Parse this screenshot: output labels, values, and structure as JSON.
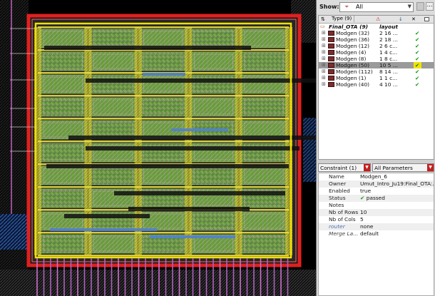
{
  "show_bar": {
    "label": "Show:",
    "filter_value": "All",
    "filter_icon": "funnel-icon"
  },
  "tree": {
    "columns": {
      "type": "Type (9)"
    },
    "root": {
      "name": "Final_OTA (9)",
      "value": "layout"
    },
    "rows": [
      {
        "name": "Modgen (32)",
        "value": "2 16 ...",
        "status": "✔"
      },
      {
        "name": "Modgen (36)",
        "value": "2 18 ...",
        "status": "✔"
      },
      {
        "name": "Modgen (12)",
        "value": "2 6 c...",
        "status": "✔"
      },
      {
        "name": "Modgen (4)",
        "value": "1 4 c...",
        "status": "✔"
      },
      {
        "name": "Modgen (8)",
        "value": "1 8 c...",
        "status": "✔"
      },
      {
        "name": "Modgen (50)",
        "value": "10 5 ...",
        "status": "✔"
      },
      {
        "name": "Modgen (112)",
        "value": "8 14 ...",
        "status": "✔"
      },
      {
        "name": "Modgen (1)",
        "value": "1 1 c...",
        "status": "✔"
      },
      {
        "name": "Modgen (40)",
        "value": "4 10 ...",
        "status": "✔"
      }
    ],
    "selected_index": 5
  },
  "constraint_bar": {
    "constraint_label": "Constraint (1)",
    "params_label": "All Parameters"
  },
  "properties": [
    {
      "key": "Name",
      "value": "Modgen_6"
    },
    {
      "key": "Owner",
      "value": "Umut_Intro_Ju19:Final_OTA:..."
    },
    {
      "key": "Enabled",
      "value": "true"
    },
    {
      "key": "Status",
      "value": "passed",
      "icon": "✔"
    },
    {
      "key": "Notes",
      "value": ""
    },
    {
      "key": "Nb of Rows",
      "value": "10"
    },
    {
      "key": "Nb of Cols",
      "value": "5"
    },
    {
      "key": "router",
      "value": "none"
    },
    {
      "key": "Merge La...",
      "value": "default"
    }
  ],
  "colors": {
    "background": "#000000",
    "outer_boundary": "#e02020",
    "inner_boundary": "#f0e000",
    "diffusion_green": "#6aaa3a",
    "metal_pink": "#d070d0",
    "metal_blue": "#5080c0",
    "check_green": "#1a9a1a",
    "selection_yellow": "#f2e300"
  }
}
